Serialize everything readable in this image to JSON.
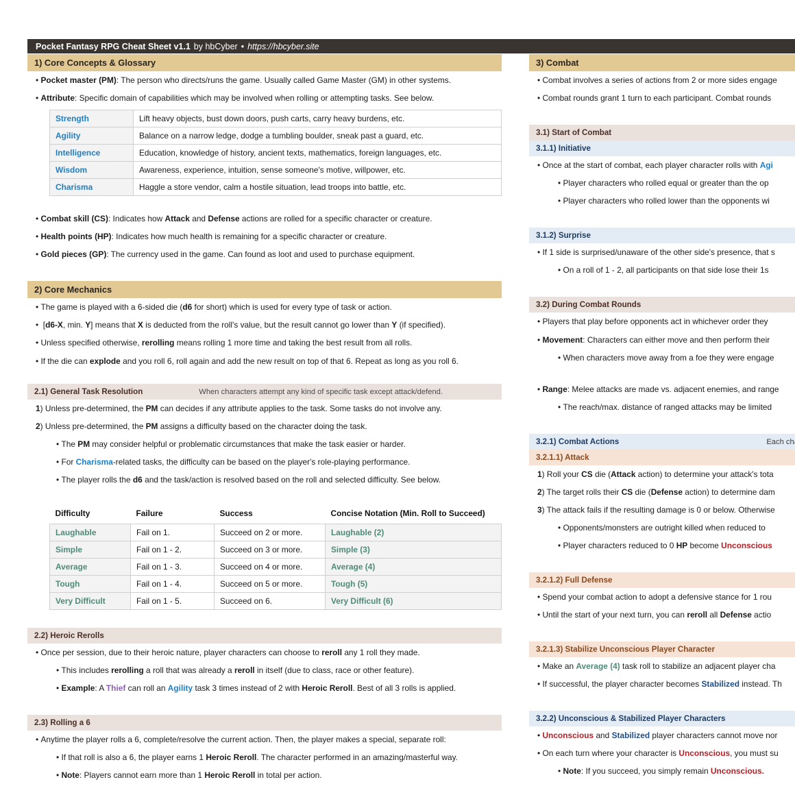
{
  "titlebar": {
    "title": "Pocket Fantasy RPG Cheat Sheet v1.1",
    "by": "by hbCyber",
    "separator": "•",
    "url": "https://hbcyber.site"
  },
  "colors": {
    "section_bar": "#e2c893",
    "subsection_bar": "#eae1dd",
    "blue_bar": "#e3ecf5",
    "peach_bar": "#f7e3d6",
    "titlebar": "#3a3430",
    "attribute_blue": "#1f7fc4",
    "difficulty_teal": "#4f8a79",
    "class_purple": "#8b5fb5",
    "status_red": "#b81f26",
    "status_navy": "#1f4e8c"
  },
  "left_column": {
    "s1_heading": "1) Core Concepts & Glossary",
    "s1_b1_term": "Pocket master (PM)",
    "s1_b1_text": ": The person who directs/runs the game. Usually called Game Master (GM) in other systems.",
    "s1_b2_term": "Attribute",
    "s1_b2_text": ": Specific domain of capabilities which may be involved when rolling or attempting tasks. See below.",
    "attributes_table": [
      {
        "name": "Strength",
        "desc": "Lift heavy objects, bust down doors, push carts, carry heavy burdens, etc."
      },
      {
        "name": "Agility",
        "desc": "Balance on a narrow ledge, dodge a tumbling boulder, sneak past a guard, etc."
      },
      {
        "name": "Intelligence",
        "desc": "Education, knowledge of history, ancient texts, mathematics, foreign languages, etc."
      },
      {
        "name": "Wisdom",
        "desc": "Awareness, experience, intuition, sense someone's motive, willpower, etc."
      },
      {
        "name": "Charisma",
        "desc": "Haggle a store vendor, calm a hostile situation, lead troops into battle, etc."
      }
    ],
    "s1_b3_term": "Combat skill (CS)",
    "s1_b3_pre": ": Indicates how ",
    "s1_b3_attack": "Attack",
    "s1_b3_mid": " and ",
    "s1_b3_defense": "Defense",
    "s1_b3_post": " actions are rolled for a specific character or creature.",
    "s1_b4_term": "Health points (HP)",
    "s1_b4_text": ": Indicates how much health is remaining for a specific character or creature.",
    "s1_b5_term": "Gold pieces (GP)",
    "s1_b5_text": ": The currency used in the game. Can found as loot and used to purchase equipment.",
    "s2_heading": "2) Core Mechanics",
    "s2_b1_pre": "The game is played with a 6-sided die (",
    "s2_b1_d6": "d6",
    "s2_b1_post": " for short) which is used for every type of task or action.",
    "s2_b2_pre": " [",
    "s2_b2_dx": "d6-X",
    "s2_b2_mid1": ", min. ",
    "s2_b2_y": "Y",
    "s2_b2_mid2": "] means that ",
    "s2_b2_x": "X",
    "s2_b2_mid3": " is deducted from the roll's value, but the result cannot go lower than ",
    "s2_b2_y2": "Y",
    "s2_b2_post": " (if specified).",
    "s2_b3_pre": "Unless specified otherwise, ",
    "s2_b3_bold": "rerolling",
    "s2_b3_post": " means rolling 1 more time and taking the best result from all rolls.",
    "s2_b4_pre": "If the die can ",
    "s2_b4_bold": "explode",
    "s2_b4_post": " and you roll 6, roll again and add the new result on top of that 6. Repeat as long as you roll 6.",
    "s21_heading": "2.1) General Task Resolution",
    "s21_note": "When characters attempt any kind of specific task except attack/defend.",
    "s21_n1_num": "1",
    "s21_n1_pre": ") Unless pre-determined, the ",
    "s21_n1_pm": "PM",
    "s21_n1_post": " can decides if any attribute applies to the task. Some tasks do not involve any.",
    "s21_n2_num": "2",
    "s21_n2_pre": ") Unless pre-determined, the ",
    "s21_n2_pm": "PM",
    "s21_n2_post": " assigns a difficulty based on the character doing the task.",
    "s21_s1_pre": "The ",
    "s21_s1_pm": "PM",
    "s21_s1_post": " may consider helpful or problematic circumstances that make the task easier or harder.",
    "s21_s2_pre": "For ",
    "s21_s2_charisma": "Charisma",
    "s21_s2_post": "-related tasks, the difficulty can be based on the player's role-playing performance.",
    "s21_s3_pre": "The player rolls the ",
    "s21_s3_d6": "d6",
    "s21_s3_post": " and the task/action is resolved based on the roll and selected difficulty. See below.",
    "difficulty_headers": [
      "Difficulty",
      "Failure",
      "Success",
      "Concise Notation (Min. Roll to Succeed)"
    ],
    "difficulty_table": [
      {
        "difficulty": "Laughable",
        "failure": "Fail on 1.",
        "success": "Succeed on 2 or more.",
        "notation": "Laughable (2)"
      },
      {
        "difficulty": "Simple",
        "failure": "Fail on 1 - 2.",
        "success": "Succeed on 3 or more.",
        "notation": "Simple (3)"
      },
      {
        "difficulty": "Average",
        "failure": "Fail on 1 - 3.",
        "success": "Succeed on 4 or more.",
        "notation": "Average (4)"
      },
      {
        "difficulty": "Tough",
        "failure": "Fail on 1 - 4.",
        "success": "Succeed on 5 or more.",
        "notation": "Tough (5)"
      },
      {
        "difficulty": "Very Difficult",
        "failure": "Fail on 1 - 5.",
        "success": "Succeed on 6.",
        "notation": "Very Difficult (6)"
      }
    ],
    "s22_heading": "2.2) Heroic Rerolls",
    "s22_b1_pre": "Once per session, due to their heroic nature, player characters can choose to ",
    "s22_b1_bold": "reroll",
    "s22_b1_post": " any 1 roll they made.",
    "s22_s1_pre": "This includes ",
    "s22_s1_b1": "rerolling",
    "s22_s1_mid": " a roll that was already a ",
    "s22_s1_b2": "reroll",
    "s22_s1_post": " in itself (due to class, race or other feature).",
    "s22_s2_example": "Example",
    "s22_s2_pre": ": A ",
    "s22_s2_thief": "Thief",
    "s22_s2_mid1": " can roll an ",
    "s22_s2_agility": "Agility",
    "s22_s2_mid2": " task 3 times instead of 2 with ",
    "s22_s2_hr": "Heroic Reroll",
    "s22_s2_post": ". Best of all 3 rolls is applied.",
    "s23_heading": "2.3) Rolling a 6",
    "s23_b1": "Anytime the player rolls a 6, complete/resolve the current action. Then, the player makes a special, separate roll:",
    "s23_s1_pre": "If that roll is also a 6, the player earns 1 ",
    "s23_s1_hr": "Heroic Reroll",
    "s23_s1_post": ". The character performed in an amazing/masterful way.",
    "s23_s2_note": "Note",
    "s23_s2_pre": ": Players cannot earn more than 1 ",
    "s23_s2_hr": "Heroic Reroll",
    "s23_s2_post": " in total per action."
  },
  "right_column": {
    "s3_heading": "3) Combat",
    "s3_b1": "Combat involves a series of actions from 2 or more sides engage",
    "s3_b2": "Combat rounds grant 1 turn to each participant. Combat rounds",
    "s31_heading": "3.1) Start of Combat",
    "s311_heading": "3.1.1) Initiative",
    "s311_b1_pre": "Once at the start of combat, each player character rolls with ",
    "s311_b1_agi": "Agi",
    "s311_s1": "Player characters who rolled equal or greater than the op",
    "s311_s2": "Player characters who rolled lower than the opponents wi",
    "s312_heading": "3.1.2) Surprise",
    "s312_b1": "If 1 side is surprised/unaware of the other side's presence, that s",
    "s312_s1": "On a roll of 1 - 2, all participants on that side lose their 1s",
    "s32_heading": "3.2) During Combat Rounds",
    "s32_b1": "Players that play before opponents act in whichever order they",
    "s32_b2_term": "Movement",
    "s32_b2_text": ": Characters can either move and then perform their",
    "s32_s1": "When characters move away from a foe they were engage",
    "s32_b3_term": "Range",
    "s32_b3_text": ": Melee attacks are made vs. adjacent enemies, and range",
    "s32_s2": "The reach/max. distance of ranged attacks may be limited",
    "s321_heading": "3.2.1) Combat Actions",
    "s321_note": "Each characte",
    "s3211_heading": "3.2.1.1) Attack",
    "s3211_n1_num": "1",
    "s3211_n1_pre": ") Roll your ",
    "s3211_n1_cs": "CS",
    "s3211_n1_mid": " die (",
    "s3211_n1_attack": "Attack",
    "s3211_n1_post": " action) to determine your attack's tota",
    "s3211_n2_num": "2",
    "s3211_n2_pre": ") The target rolls their ",
    "s3211_n2_cs": "CS",
    "s3211_n2_mid": " die (",
    "s3211_n2_defense": "Defense",
    "s3211_n2_post": " action) to determine dam",
    "s3211_n3_num": "3",
    "s3211_n3_text": ") The attack fails if the resulting damage is 0 or below. Otherwise",
    "s3211_s1": "Opponents/monsters are outright killed when reduced to",
    "s3211_s2_pre": "Player characters reduced to 0 ",
    "s3211_s2_hp": "HP",
    "s3211_s2_mid": " become ",
    "s3211_s2_unc": "Unconscious",
    "s3212_heading": "3.2.1.2) Full Defense",
    "s3212_b1": "Spend your combat action to adopt a defensive stance for 1 rou",
    "s3212_b2_pre": "Until the start of your next turn, you can ",
    "s3212_b2_reroll": "reroll",
    "s3212_b2_mid": " all ",
    "s3212_b2_defense": "Defense",
    "s3212_b2_post": " actio",
    "s3213_heading": "3.2.1.3) Stabilize Unconscious Player Character",
    "s3213_b1_pre": "Make an ",
    "s3213_b1_avg": "Average",
    "s3213_b1_num": " (4)",
    "s3213_b1_post": " task roll to stabilize an adjacent player cha",
    "s3213_b2_pre": "If successful, the player character becomes ",
    "s3213_b2_stab": "Stabilized",
    "s3213_b2_post": " instead. Th",
    "s322_heading": "3.2.2) Unconscious & Stabilized Player Characters",
    "s322_b1_unc": "Unconscious",
    "s322_b1_mid": " and ",
    "s322_b1_stab": "Stabilized",
    "s322_b1_post": " player characters cannot move nor",
    "s322_b2_pre": "On each turn where your character is ",
    "s322_b2_unc": "Unconscious",
    "s322_b2_post": ", you must su",
    "s322_s1_note": "Note",
    "s322_s1_pre": ": If you succeed, you simply remain ",
    "s322_s1_unc": "Unconscious."
  }
}
